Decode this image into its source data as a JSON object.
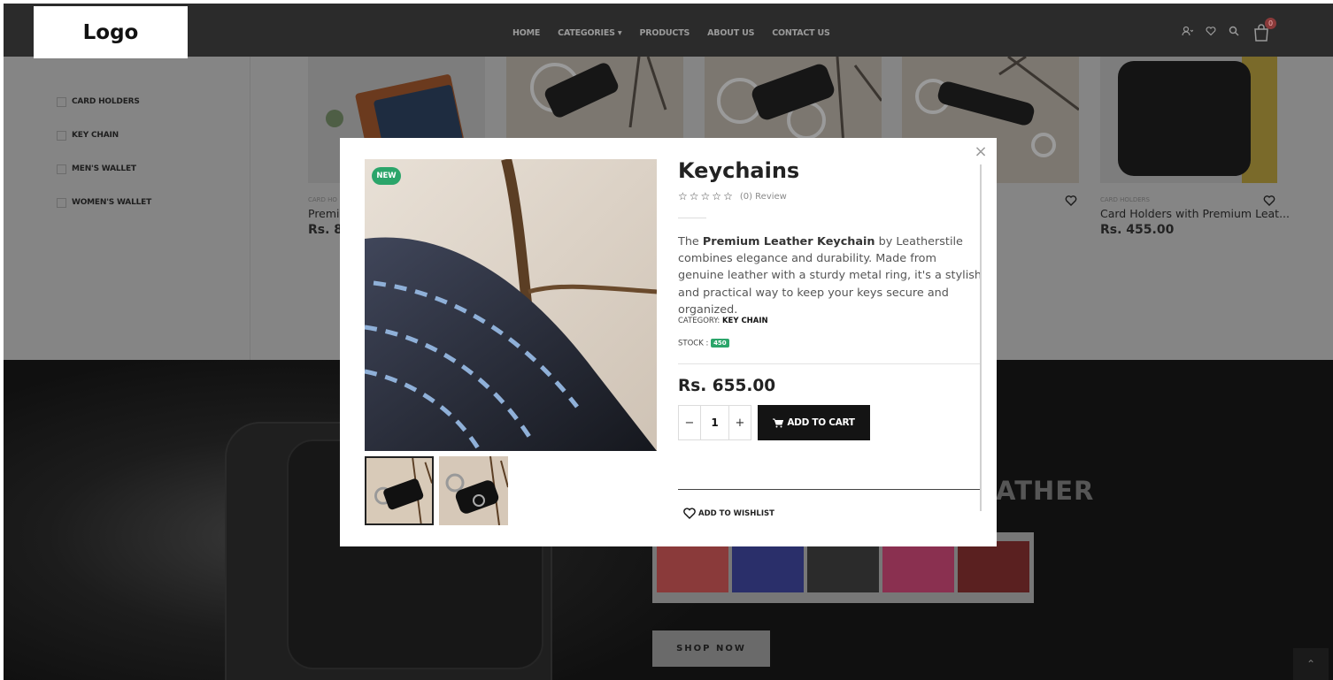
{
  "header": {
    "logo_text": "Logo",
    "nav": [
      "HOME",
      "CATEGORIES ▾",
      "PRODUCTS",
      "ABOUT US",
      "CONTACT US"
    ],
    "cart_count": "0"
  },
  "sidebar": {
    "categories": [
      "CARD HOLDERS",
      "KEY CHAIN",
      "MEN'S WALLET",
      "WOMEN'S WALLET"
    ]
  },
  "products": [
    {
      "meta": "CARD HO",
      "title": "Premi",
      "price": "Rs. 8"
    },
    {
      "meta": "CARD HOLDERS",
      "title": "Card Holders with Premium Leat...",
      "price": "Rs. 455.00"
    }
  ],
  "banner": {
    "title_partial": "ATHER",
    "shop_button": "SHOP NOW",
    "back_to_top": "⌃"
  },
  "modal": {
    "close": "×",
    "badge": "NEW",
    "title": "Keychains",
    "review_text": "(0) Review",
    "rating": 0,
    "description_pre": "The ",
    "description_bold": "Premium Leather Keychain",
    "description_post": " by Leatherstile combines elegance and durability. Made from genuine leather with a sturdy metal ring, it's a stylish and practical way to keep your keys secure and organized.",
    "category_label": "CATEGORY:",
    "category_value": "KEY CHAIN",
    "stock_label": "STOCK :",
    "stock_value": "450",
    "price": "Rs. 655.00",
    "qty_minus": "−",
    "qty_value": "1",
    "qty_plus": "+",
    "add_to_cart": "ADD TO CART",
    "wishlist": "ADD TO WISHLIST"
  },
  "colors": {
    "badge_green": "#2ba56a",
    "button_dark": "#141414",
    "header_bg": "#2b2b2b"
  }
}
